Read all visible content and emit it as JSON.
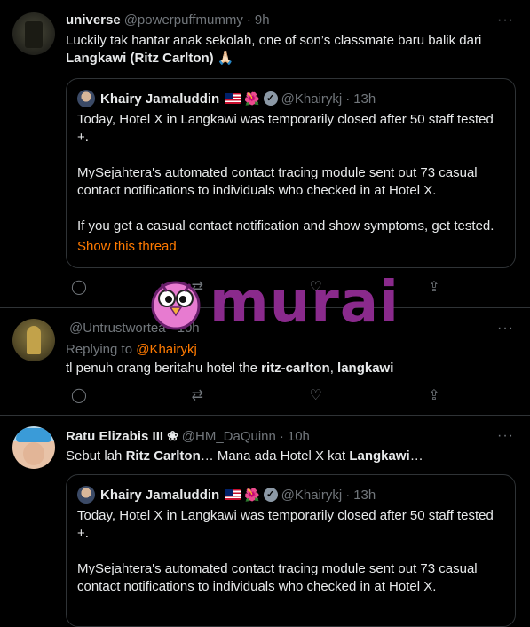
{
  "tweets": [
    {
      "name": "universe",
      "handle": "@powerpuffmummy",
      "sep": "·",
      "time": "9h",
      "more": "···",
      "body_plain_1": "Luckily tak hantar anak sekolah, one of son’s classmate baru balik dari ",
      "body_bold": "Langkawi (Ritz Carlton)",
      "body_emoji": " 🙏🏻",
      "quote": {
        "name": "Khairy Jamaluddin",
        "flower": "🌺",
        "verified": "✓",
        "handle": "@Khairykj",
        "sep": "·",
        "time": "13h",
        "p1": "Today, Hotel X in Langkawi was temporarily closed after 50 staff tested +.",
        "p2": "MySejahtera's automated contact tracing module sent out 73 casual contact notifications to individuals who checked in at Hotel X.",
        "p3": "If you get a casual contact notification and show symptoms, get tested.",
        "show_thread": "Show this thread"
      }
    },
    {
      "name": "",
      "handle": "@Untrustwortea",
      "sep": "·",
      "time": "10h",
      "more": "···",
      "replying_label": "Replying to ",
      "replying_to": "@Khairykj",
      "body_plain_1": "tl penuh orang beritahu hotel the ",
      "body_bold_1": "ritz-carlton",
      "body_plain_2": ", ",
      "body_bold_2": "langkawi"
    },
    {
      "name": "Ratu Elizabis III ❀",
      "handle": "@HM_DaQuinn",
      "sep": "·",
      "time": "10h",
      "more": "···",
      "body_plain_1": "Sebut lah ",
      "body_bold_1": "Ritz Carlton",
      "body_plain_2": "… Mana ada Hotel X kat ",
      "body_bold_2": "Langkawi",
      "body_plain_3": "…",
      "quote": {
        "name": "Khairy Jamaluddin",
        "flower": "🌺",
        "verified": "✓",
        "handle": "@Khairykj",
        "sep": "·",
        "time": "13h",
        "p1": "Today, Hotel X in Langkawi was temporarily closed after 50 staff tested +.",
        "p2": "MySejahtera's automated contact tracing module sent out 73 casual contact notifications to individuals who checked in at Hotel X."
      }
    }
  ],
  "actions": {
    "reply": "◯",
    "retweet": "⇄",
    "like": "♡",
    "share": "⇪"
  },
  "watermark": {
    "text": "murai"
  },
  "colors": {
    "background": "#000000",
    "accent": "#ff7a00",
    "muted": "#71767b",
    "watermark": "#8a2a8c"
  }
}
